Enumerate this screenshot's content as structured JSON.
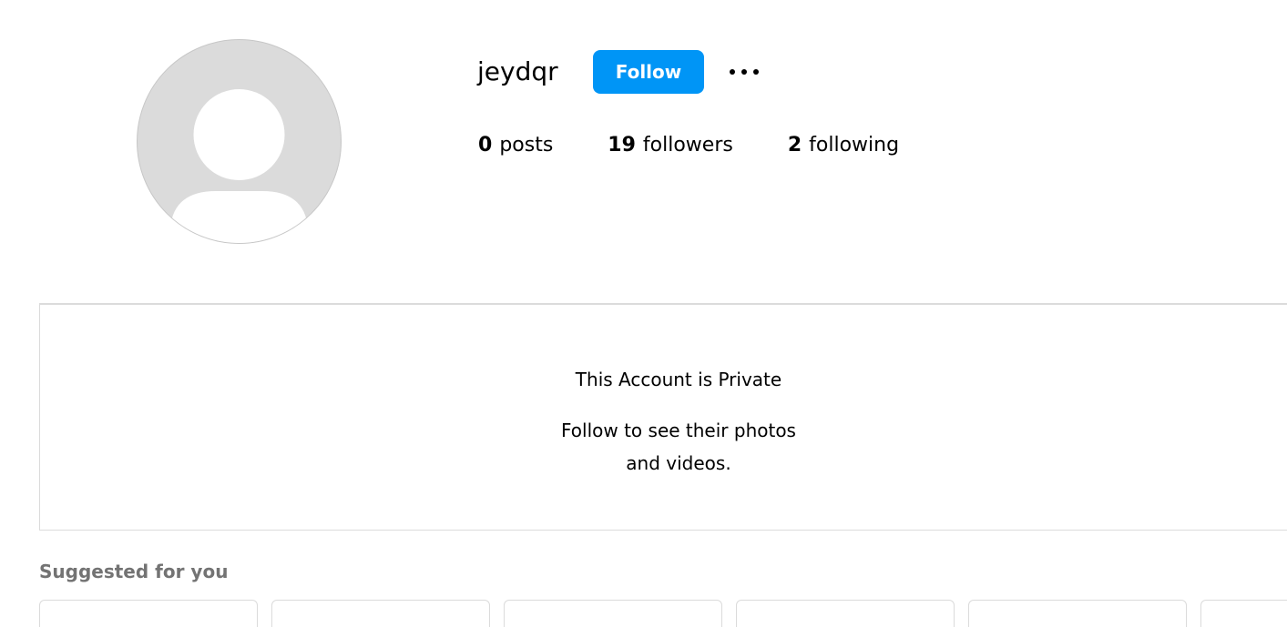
{
  "profile": {
    "username": "jeydqr",
    "follow_label": "Follow",
    "more_icon": "more-options-icon",
    "avatar_icon": "default-avatar-icon"
  },
  "stats": {
    "posts_count": "0",
    "posts_label": "posts",
    "followers_count": "19",
    "followers_label": "followers",
    "following_count": "2",
    "following_label": "following"
  },
  "private_notice": {
    "title": "This Account is Private",
    "subtitle": "Follow to see their photos and videos."
  },
  "suggested": {
    "heading": "Suggested for you",
    "card_count": 6
  },
  "colors": {
    "accent": "#0095f6",
    "muted_text": "#737373",
    "border": "#dbdbdb",
    "avatar_bg": "#dbdbdb"
  }
}
